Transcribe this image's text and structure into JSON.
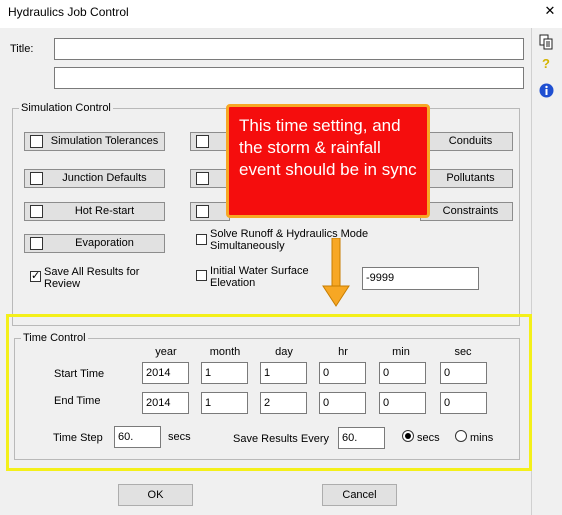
{
  "window": {
    "title": "Hydraulics Job Control",
    "close_glyph": "✕"
  },
  "toolbar": {
    "copy_icon": "copy-icon",
    "help_icon": "help-icon",
    "info_icon": "info-icon"
  },
  "fields": {
    "title_label": "Title:",
    "title_line1": "",
    "title_line2": ""
  },
  "simulation_control": {
    "label": "Simulation Control",
    "buttons": [
      "Simulation Tolerances",
      "Junction Defaults",
      "Hot Re-start",
      "Evaporation"
    ],
    "right_buttons": [
      "Conduits",
      "Pollutants",
      "Constraints"
    ],
    "solve_runoff_label": "Solve Runoff & Hydraulics Mode Simultaneously",
    "save_all_label": "Save All Results for Review",
    "save_all_checked": true,
    "initial_ws_label": "Initial Water Surface Elevation",
    "initial_ws_value": "-9999"
  },
  "callout": {
    "text": "This time setting, and the storm & rainfall event should be in sync"
  },
  "time_control": {
    "label": "Time Control",
    "headers": [
      "year",
      "month",
      "day",
      "hr",
      "min",
      "sec"
    ],
    "start_label": "Start Time",
    "start": [
      "2014",
      "1",
      "1",
      "0",
      "0",
      "0"
    ],
    "end_label": "End Time",
    "end": [
      "2014",
      "1",
      "2",
      "0",
      "0",
      "0"
    ],
    "time_step_label": "Time Step",
    "time_step_value": "60.",
    "time_step_unit": "secs",
    "save_every_label": "Save Results Every",
    "save_every_value": "60.",
    "unit_secs": "secs",
    "unit_mins": "mins",
    "selected_unit": "secs"
  },
  "actions": {
    "ok": "OK",
    "cancel": "Cancel"
  },
  "colors": {
    "callout_bg": "#f50d0d",
    "callout_border": "#f7a724",
    "highlight": "#f4f01a",
    "arrow": "#f7a724"
  }
}
